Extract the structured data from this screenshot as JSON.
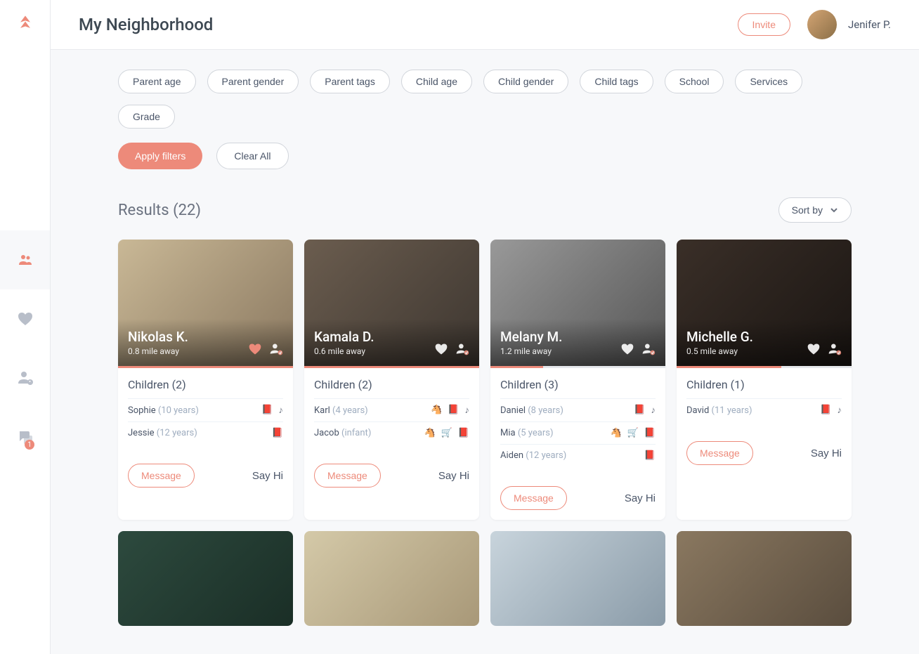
{
  "header": {
    "title": "My Neighborhood",
    "invite_label": "Invite",
    "user_name": "Jenifer P."
  },
  "sidebar": {
    "chat_badge": "1"
  },
  "filters": [
    "Parent age",
    "Parent gender",
    "Parent tags",
    "Child age",
    "Child gender",
    "Child tags",
    "School",
    "Services",
    "Grade"
  ],
  "filter_actions": {
    "apply_label": "Apply filters",
    "clear_label": "Clear All"
  },
  "results": {
    "title": "Results (22)",
    "sort_label": "Sort by"
  },
  "cards": [
    {
      "name": "Nikolas K.",
      "distance": "0.8 mile away",
      "heart_filled": true,
      "progress": 100,
      "children_label": "Children (2)",
      "children": [
        {
          "name": "Sophie",
          "age": "(10 years)",
          "icons": [
            "📕",
            "♪"
          ]
        },
        {
          "name": "Jessie",
          "age": "(12 years)",
          "icons": [
            "📕"
          ]
        }
      ]
    },
    {
      "name": "Kamala D.",
      "distance": "0.6 mile away",
      "heart_filled": false,
      "progress": 100,
      "children_label": "Children (2)",
      "children": [
        {
          "name": "Karl",
          "age": "(4 years)",
          "icons": [
            "🐴",
            "📕",
            "♪"
          ]
        },
        {
          "name": "Jacob",
          "age": "(infant)",
          "icons": [
            "🐴",
            "🛒",
            "📕"
          ]
        }
      ]
    },
    {
      "name": "Melany M.",
      "distance": "1.2 mile away",
      "heart_filled": false,
      "progress": 30,
      "children_label": "Children (3)",
      "children": [
        {
          "name": "Daniel",
          "age": "(8 years)",
          "icons": [
            "📕",
            "♪"
          ]
        },
        {
          "name": "Mia",
          "age": "(5 years)",
          "icons": [
            "🐴",
            "🛒",
            "📕"
          ]
        },
        {
          "name": "Aiden",
          "age": "(12 years)",
          "icons": [
            "📕"
          ]
        }
      ]
    },
    {
      "name": "Michelle G.",
      "distance": "0.5 mile away",
      "heart_filled": false,
      "progress": 60,
      "children_label": "Children (1)",
      "children": [
        {
          "name": "David",
          "age": "(11 years)",
          "icons": [
            "📕",
            "♪"
          ]
        }
      ]
    }
  ],
  "card_actions": {
    "message_label": "Message",
    "sayhi_label": "Say Hi"
  }
}
